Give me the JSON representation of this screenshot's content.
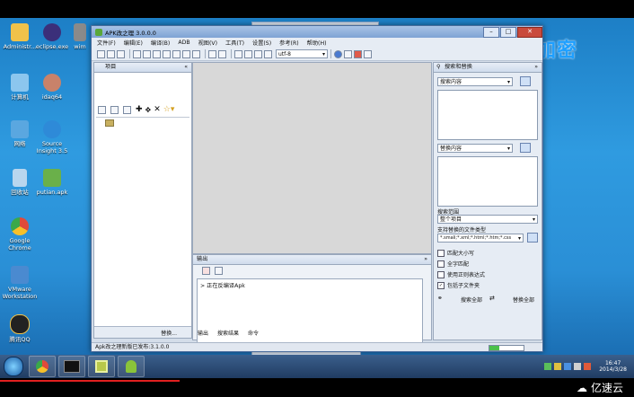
{
  "desktop_icons": [
    {
      "label": "Administr...",
      "color": "#f0c24a"
    },
    {
      "label": "eclipse.exe",
      "color": "#3b2f7a"
    },
    {
      "label": "wim",
      "color": "#6a6a6a"
    },
    {
      "label": "计算机",
      "color": "#8cc6ee"
    },
    {
      "label": "idaq64",
      "color": "#c8826a"
    },
    {
      "label": "网络",
      "color": "#5aa7e0"
    },
    {
      "label": "Source Insight 3.5",
      "color": "#2e8ad8"
    },
    {
      "label": "回收站",
      "color": "#b8d6ee"
    },
    {
      "label": "putian.apk",
      "color": "#6ab04a"
    },
    {
      "label": "Google Chrome",
      "color": "#e04a3a"
    },
    {
      "label": "VMware Workstation",
      "color": "#4a8ad0"
    },
    {
      "label": "腾讯QQ",
      "color": "#222222"
    }
  ],
  "watermark": "爱加密",
  "app": {
    "title": "APK改之理 3.0.0.0",
    "menus": [
      "文件(F)",
      "编辑(E)",
      "编译(B)",
      "ADB",
      "视图(V)",
      "工具(T)",
      "设置(S)",
      "参考(R)",
      "帮助(H)"
    ],
    "encoding": "utf-8",
    "project_panel_title": "项目",
    "output_panel_title": "输出",
    "output_text": "> 正在反编译Apk",
    "bottom_tabs": [
      "输出",
      "搜索结果",
      "命令"
    ],
    "left_bottom_button": "替换...",
    "statusbar": "Apk改之理新版已发布:3.1.0.0",
    "right_panel": {
      "title": "搜索和替换",
      "search_combo": "搜索内容",
      "replace_combo": "替换内容",
      "scope_label": "搜索范围",
      "scope_value": "整个项目",
      "types_label": "支持替换的文件类型",
      "types_value": "*.smali;*.xml;*.html;*.htm;*.css",
      "checks": [
        {
          "label": "匹配大小写",
          "checked": false
        },
        {
          "label": "全字匹配",
          "checked": false
        },
        {
          "label": "使用正则表达式",
          "checked": false
        },
        {
          "label": "包括子文件夹",
          "checked": true
        }
      ],
      "search_all_button": "搜索全部",
      "replace_all_button": "替换全部"
    }
  },
  "taskbar": {
    "time": "16:47",
    "date": "2014/3/28"
  },
  "brand": "亿速云"
}
